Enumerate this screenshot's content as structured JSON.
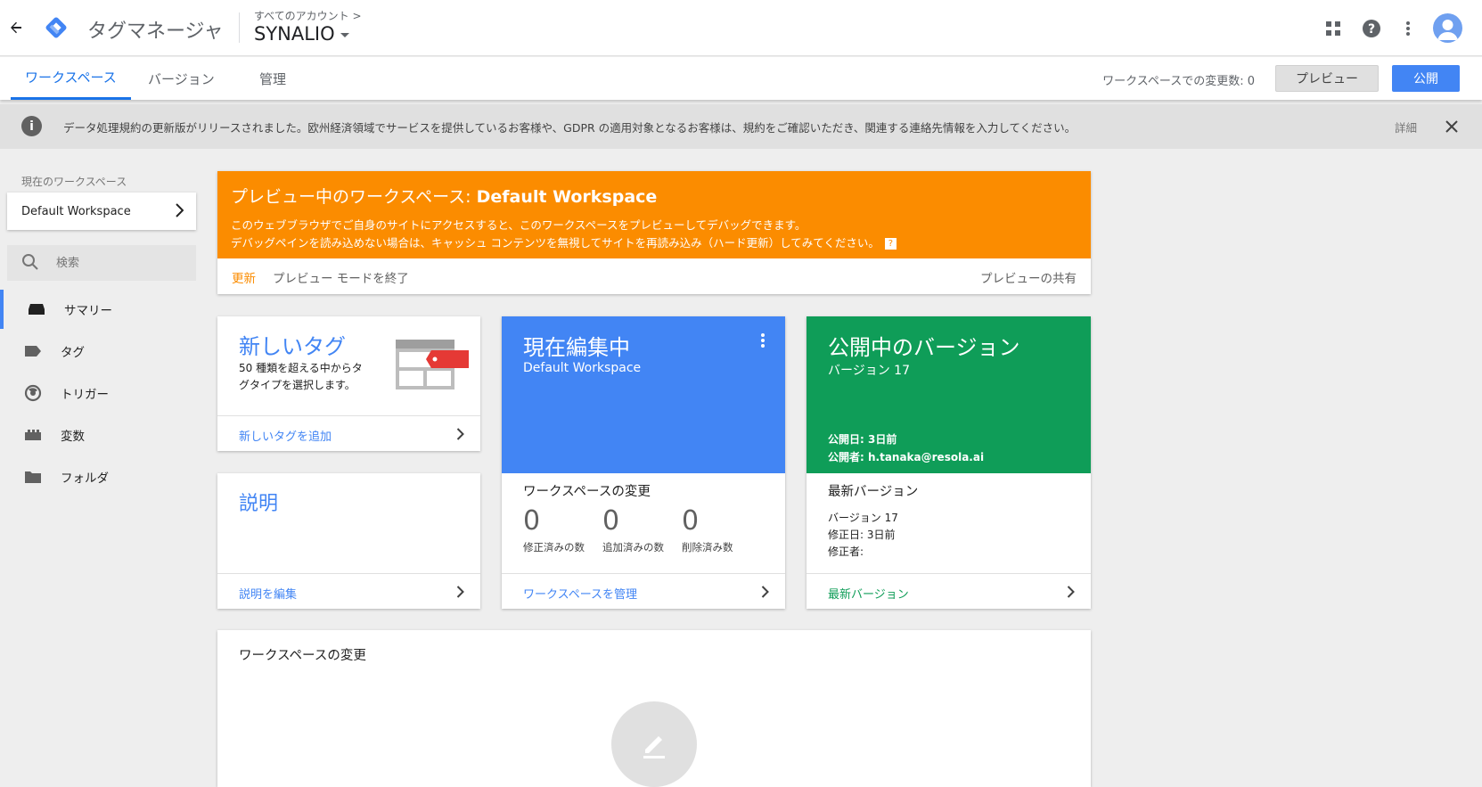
{
  "header": {
    "product_name": "タグマネージャ",
    "breadcrumb": "すべてのアカウント >",
    "account_name": "SYNALIO",
    "icons": [
      "back-arrow-icon",
      "gtm-logo",
      "apps-grid-icon",
      "help-icon",
      "more-vert-icon",
      "avatar"
    ]
  },
  "tabs": {
    "items": [
      {
        "label": "ワークスペース",
        "active": true
      },
      {
        "label": "バージョン",
        "active": false
      },
      {
        "label": "管理",
        "active": false
      }
    ],
    "changes_text": "ワークスペースでの変更数: 0",
    "preview_label": "プレビュー",
    "publish_label": "公開"
  },
  "notice": {
    "text": "データ処理規約の更新版がリリースされました。欧州経済領域でサービスを提供しているお客様や、GDPR の適用対象となるお客様は、規約をご確認いただき、関連する連絡先情報を入力してください。",
    "detail_label": "詳細"
  },
  "sidebar": {
    "workspace_label": "現在のワークスペース",
    "workspace_name": "Default Workspace",
    "search_placeholder": "検索",
    "items": [
      {
        "label": "サマリー",
        "icon": "summary-icon",
        "active": true
      },
      {
        "label": "タグ",
        "icon": "tag-icon",
        "active": false
      },
      {
        "label": "トリガー",
        "icon": "trigger-icon",
        "active": false
      },
      {
        "label": "変数",
        "icon": "variable-icon",
        "active": false
      },
      {
        "label": "フォルダ",
        "icon": "folder-icon",
        "active": false
      }
    ]
  },
  "preview_banner": {
    "title_prefix": "プレビュー中のワークスペース: ",
    "title_workspace": "Default Workspace",
    "line1": "このウェブブラウザでご自身のサイトにアクセスすると、このワークスペースをプレビューしてデバッグできます。",
    "line2": "デバッグペインを読み込めない場合は、キャッシュ コンテンツを無視してサイトを再読み込み（ハード更新）してみてください。",
    "help_glyph": "?",
    "refresh_label": "更新",
    "exit_label": "プレビュー モードを終了",
    "share_label": "プレビューの共有"
  },
  "new_tag": {
    "title": "新しいタグ",
    "description": "50 種類を超える中からタグタイプを選択します。",
    "link": "新しいタグを追加"
  },
  "description_card": {
    "title": "説明",
    "link": "説明を編集"
  },
  "editing": {
    "title": "現在編集中",
    "workspace": "Default Workspace",
    "changes_title": "ワークスペースの変更",
    "stats": [
      {
        "value": "0",
        "label": "修正済みの数"
      },
      {
        "value": "0",
        "label": "追加済みの数"
      },
      {
        "value": "0",
        "label": "削除済み数"
      }
    ],
    "link": "ワークスペースを管理"
  },
  "published": {
    "title": "公開中のバージョン",
    "version": "バージョン 17",
    "published_date": "公開日: 3日前",
    "published_by": "公開者: h.tanaka@resola.ai",
    "latest_title": "最新バージョン",
    "latest_version": "バージョン 17",
    "modified_date": "修正日: 3日前",
    "modified_by": "修正者:",
    "link": "最新バージョン"
  },
  "workspace_changes": {
    "title": "ワークスペースの変更"
  },
  "colors": {
    "primary_blue": "#4285f4",
    "orange": "#fb8c00",
    "green": "#0f9d58"
  }
}
